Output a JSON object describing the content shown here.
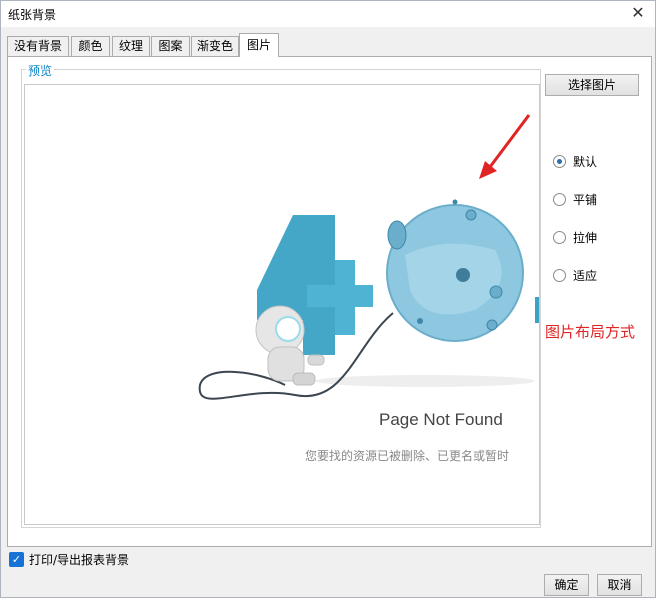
{
  "window": {
    "title": "纸张背景",
    "close_glyph": "✕"
  },
  "tabs": [
    {
      "label": "没有背景"
    },
    {
      "label": "颜色"
    },
    {
      "label": "纹理"
    },
    {
      "label": "图案"
    },
    {
      "label": "渐变色"
    },
    {
      "label": "图片",
      "active": true
    }
  ],
  "preview": {
    "legend": "预览",
    "image": {
      "title": "Page Not Found",
      "subtitle": "您要找的资源已被删除、已更名或暂时",
      "accent_color": "#3aa2c4",
      "planet_color": "#8ec8e0"
    }
  },
  "select_image_button": "选择图片",
  "layout_options": [
    {
      "label": "默认",
      "selected": true
    },
    {
      "label": "平铺",
      "selected": false
    },
    {
      "label": "拉伸",
      "selected": false
    },
    {
      "label": "适应",
      "selected": false
    }
  ],
  "annotation": {
    "text": "图片布局方式",
    "color": "#e02424"
  },
  "print_export_background": {
    "label": "打印/导出报表背景",
    "checked": true
  },
  "buttons": {
    "ok": "确定",
    "cancel": "取消"
  }
}
